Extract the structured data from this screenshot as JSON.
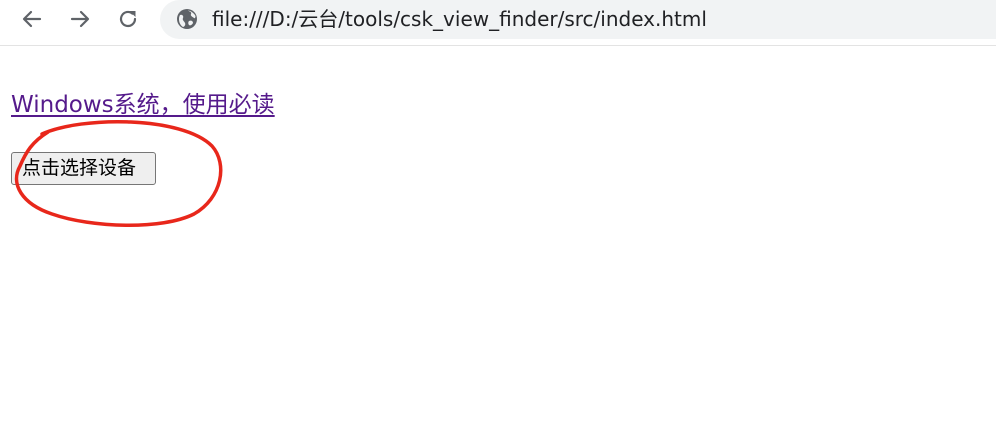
{
  "browser": {
    "back_icon": "arrow-left-icon",
    "forward_icon": "arrow-right-icon",
    "reload_icon": "reload-icon",
    "site_icon": "globe-icon",
    "url": "file:///D:/云台/tools/csk_view_finder/src/index.html"
  },
  "page": {
    "link_text": "Windows系统，使用必读",
    "link_color": "#551a8b",
    "button_label": "点击选择设备"
  },
  "annotation": {
    "shape": "ellipse",
    "color": "#e8271b"
  }
}
